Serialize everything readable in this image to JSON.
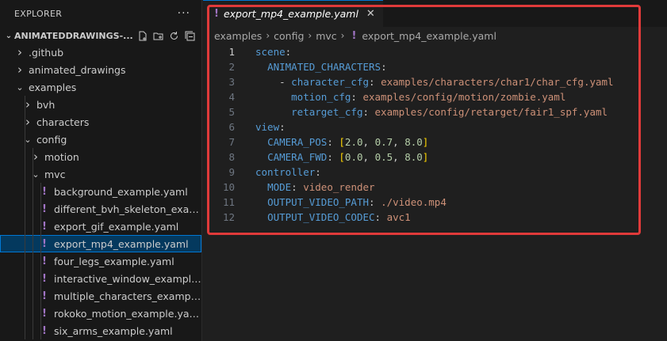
{
  "explorer": {
    "title": "EXPLORER",
    "more": "···",
    "workspace": "ANIMATEDDRAWINGS-...",
    "tree": [
      {
        "label": ".github",
        "depth": 1,
        "type": "folder",
        "open": false
      },
      {
        "label": "animated_drawings",
        "depth": 1,
        "type": "folder",
        "open": false
      },
      {
        "label": "examples",
        "depth": 1,
        "type": "folder",
        "open": true
      },
      {
        "label": "bvh",
        "depth": 2,
        "type": "folder",
        "open": false
      },
      {
        "label": "characters",
        "depth": 2,
        "type": "folder",
        "open": false
      },
      {
        "label": "config",
        "depth": 2,
        "type": "folder",
        "open": true
      },
      {
        "label": "motion",
        "depth": 3,
        "type": "folder",
        "open": false
      },
      {
        "label": "mvc",
        "depth": 3,
        "type": "folder",
        "open": true
      },
      {
        "label": "background_example.yaml",
        "depth": 4,
        "type": "yaml"
      },
      {
        "label": "different_bvh_skeleton_example....",
        "depth": 4,
        "type": "yaml"
      },
      {
        "label": "export_gif_example.yaml",
        "depth": 4,
        "type": "yaml"
      },
      {
        "label": "export_mp4_example.yaml",
        "depth": 4,
        "type": "yaml",
        "selected": true
      },
      {
        "label": "four_legs_example.yaml",
        "depth": 4,
        "type": "yaml"
      },
      {
        "label": "interactive_window_example.yaml",
        "depth": 4,
        "type": "yaml"
      },
      {
        "label": "multiple_characters_example.yaml",
        "depth": 4,
        "type": "yaml"
      },
      {
        "label": "rokoko_motion_example.yaml",
        "depth": 4,
        "type": "yaml"
      },
      {
        "label": "six_arms_example.yaml",
        "depth": 4,
        "type": "yaml"
      }
    ]
  },
  "tab": {
    "title": "export_mp4_example.yaml",
    "close": "✕"
  },
  "breadcrumb": [
    "examples",
    "config",
    "mvc",
    "export_mp4_example.yaml"
  ],
  "code": [
    {
      "n": "1",
      "indent": 0,
      "tokens": [
        [
          "key",
          "scene"
        ],
        [
          "pun",
          ":"
        ]
      ]
    },
    {
      "n": "2",
      "indent": 1,
      "tokens": [
        [
          "key",
          "ANIMATED_CHARACTERS"
        ],
        [
          "pun",
          ":"
        ]
      ]
    },
    {
      "n": "3",
      "indent": 2,
      "tokens": [
        [
          "pun",
          "- "
        ],
        [
          "key",
          "character_cfg"
        ],
        [
          "pun",
          ": "
        ],
        [
          "str",
          "examples/characters/char1/char_cfg.yaml"
        ]
      ]
    },
    {
      "n": "4",
      "indent": 3,
      "tokens": [
        [
          "key",
          "motion_cfg"
        ],
        [
          "pun",
          ": "
        ],
        [
          "str",
          "examples/config/motion/zombie.yaml"
        ]
      ]
    },
    {
      "n": "5",
      "indent": 3,
      "tokens": [
        [
          "key",
          "retarget_cfg"
        ],
        [
          "pun",
          ": "
        ],
        [
          "str",
          "examples/config/retarget/fair1_spf.yaml"
        ]
      ]
    },
    {
      "n": "6",
      "indent": 0,
      "tokens": [
        [
          "key",
          "view"
        ],
        [
          "pun",
          ":"
        ]
      ]
    },
    {
      "n": "7",
      "indent": 1,
      "tokens": [
        [
          "key",
          "CAMERA_POS"
        ],
        [
          "pun",
          ": "
        ],
        [
          "brk",
          "["
        ],
        [
          "num",
          "2.0"
        ],
        [
          "pun",
          ", "
        ],
        [
          "num",
          "0.7"
        ],
        [
          "pun",
          ", "
        ],
        [
          "num",
          "8.0"
        ],
        [
          "brk",
          "]"
        ]
      ]
    },
    {
      "n": "8",
      "indent": 1,
      "tokens": [
        [
          "key",
          "CAMERA_FWD"
        ],
        [
          "pun",
          ": "
        ],
        [
          "brk",
          "["
        ],
        [
          "num",
          "0.0"
        ],
        [
          "pun",
          ", "
        ],
        [
          "num",
          "0.5"
        ],
        [
          "pun",
          ", "
        ],
        [
          "num",
          "8.0"
        ],
        [
          "brk",
          "]"
        ]
      ]
    },
    {
      "n": "9",
      "indent": 0,
      "tokens": [
        [
          "key",
          "controller"
        ],
        [
          "pun",
          ":"
        ]
      ]
    },
    {
      "n": "10",
      "indent": 1,
      "tokens": [
        [
          "key",
          "MODE"
        ],
        [
          "pun",
          ": "
        ],
        [
          "str",
          "video_render"
        ]
      ]
    },
    {
      "n": "11",
      "indent": 1,
      "tokens": [
        [
          "key",
          "OUTPUT_VIDEO_PATH"
        ],
        [
          "pun",
          ": "
        ],
        [
          "str",
          "./video.mp4"
        ]
      ]
    },
    {
      "n": "12",
      "indent": 1,
      "tokens": [
        [
          "key",
          "OUTPUT_VIDEO_CODEC"
        ],
        [
          "pun",
          ": "
        ],
        [
          "str",
          "avc1"
        ]
      ]
    }
  ],
  "colors": {
    "accent": "#0078d4",
    "highlight_border": "#e03a3a",
    "yaml_icon": "#a074c4"
  }
}
